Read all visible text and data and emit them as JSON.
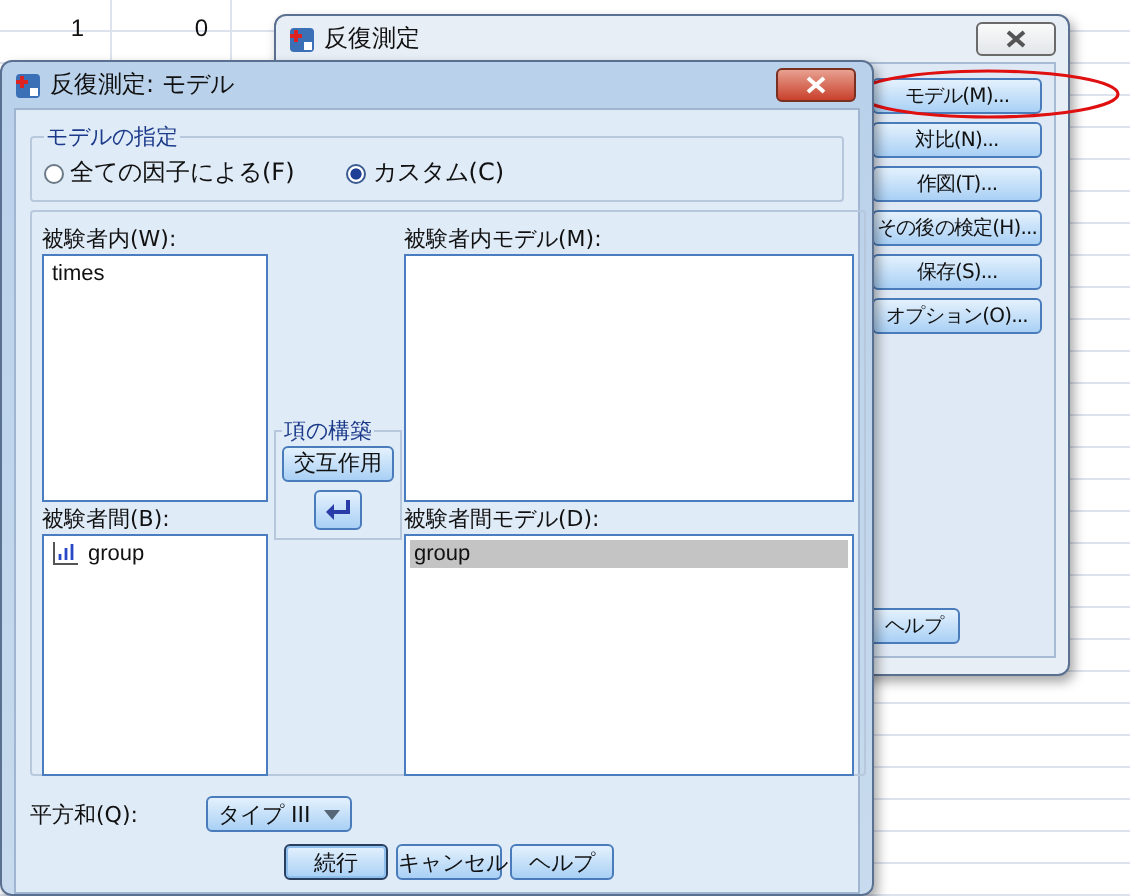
{
  "spreadsheet": {
    "rows": [
      [
        "1",
        "0"
      ]
    ]
  },
  "back_dialog": {
    "title": "反復測定",
    "buttons": [
      {
        "label": "モデル(M)...",
        "circled": true
      },
      {
        "label": "対比(N)...",
        "circled": false
      },
      {
        "label": "作図(T)...",
        "circled": false
      },
      {
        "label": "その後の検定(H)...",
        "circled": false
      },
      {
        "label": "保存(S)...",
        "circled": false
      },
      {
        "label": "オプション(O)...",
        "circled": false
      }
    ],
    "help_button": "ヘルプ"
  },
  "front_dialog": {
    "title": "反復測定: モデル",
    "model_group": {
      "title": "モデルの指定",
      "options": [
        {
          "label": "全ての因子による(F)",
          "selected": false
        },
        {
          "label": "カスタム(C)",
          "selected": true
        }
      ]
    },
    "within_label": "被験者内(W):",
    "within_items": [
      {
        "label": "times",
        "selected": false
      }
    ],
    "between_label": "被験者間(B):",
    "between_items": [
      {
        "label": "group",
        "selected": false,
        "kind": "scale"
      }
    ],
    "within_model_label": "被験者内モデル(M):",
    "between_model_label": "被験者間モデル(D):",
    "between_model_items": [
      {
        "label": "group",
        "selected": true
      }
    ],
    "build_terms": {
      "title": "項の構築",
      "type": "交互作用"
    },
    "sum_of_squares": {
      "label": "平方和(Q):",
      "value": "タイプ III"
    },
    "buttons": [
      {
        "label": "続行",
        "default": true
      },
      {
        "label": "キャンセル",
        "default": false
      },
      {
        "label": "ヘルプ",
        "default": false
      }
    ]
  }
}
